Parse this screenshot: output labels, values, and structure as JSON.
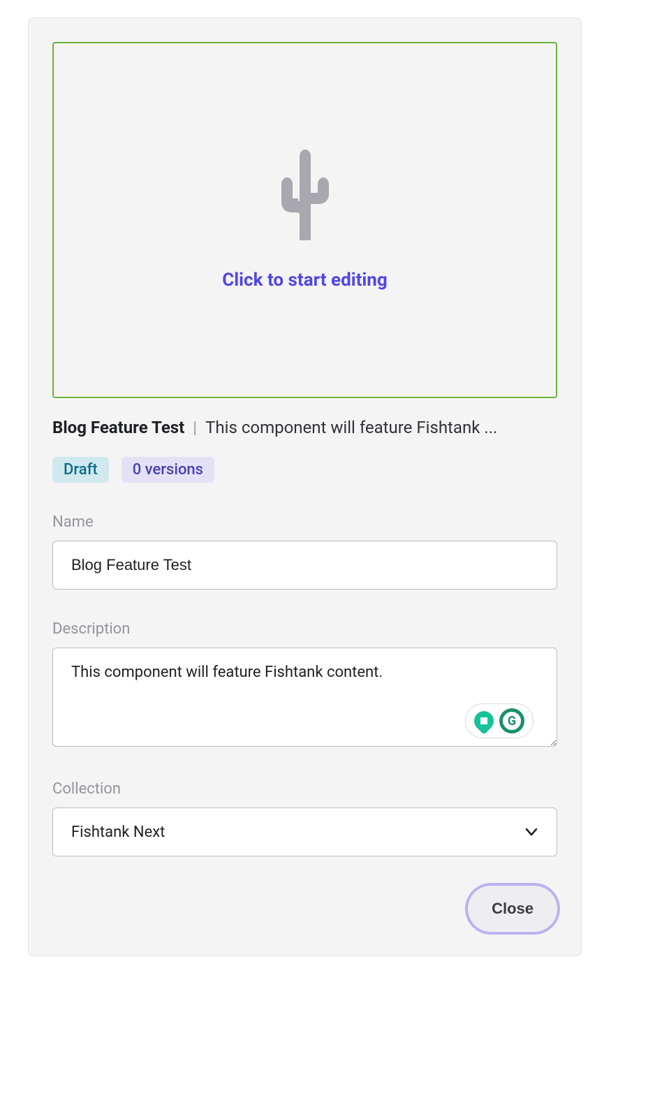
{
  "preview": {
    "cta": "Click to start editing",
    "icon": "cactus-icon"
  },
  "header": {
    "title": "Blog Feature Test",
    "separator": "|",
    "descriptionTruncated": "This component will feature Fishtank ..."
  },
  "status": {
    "stateBadge": "Draft",
    "versionsBadge": "0 versions"
  },
  "fields": {
    "name": {
      "label": "Name",
      "value": "Blog Feature Test"
    },
    "description": {
      "label": "Description",
      "value": "This component will feature Fishtank content."
    },
    "collection": {
      "label": "Collection",
      "selected": "Fishtank Next"
    }
  },
  "actions": {
    "close": "Close"
  },
  "grammarly": {
    "letter": "G"
  }
}
